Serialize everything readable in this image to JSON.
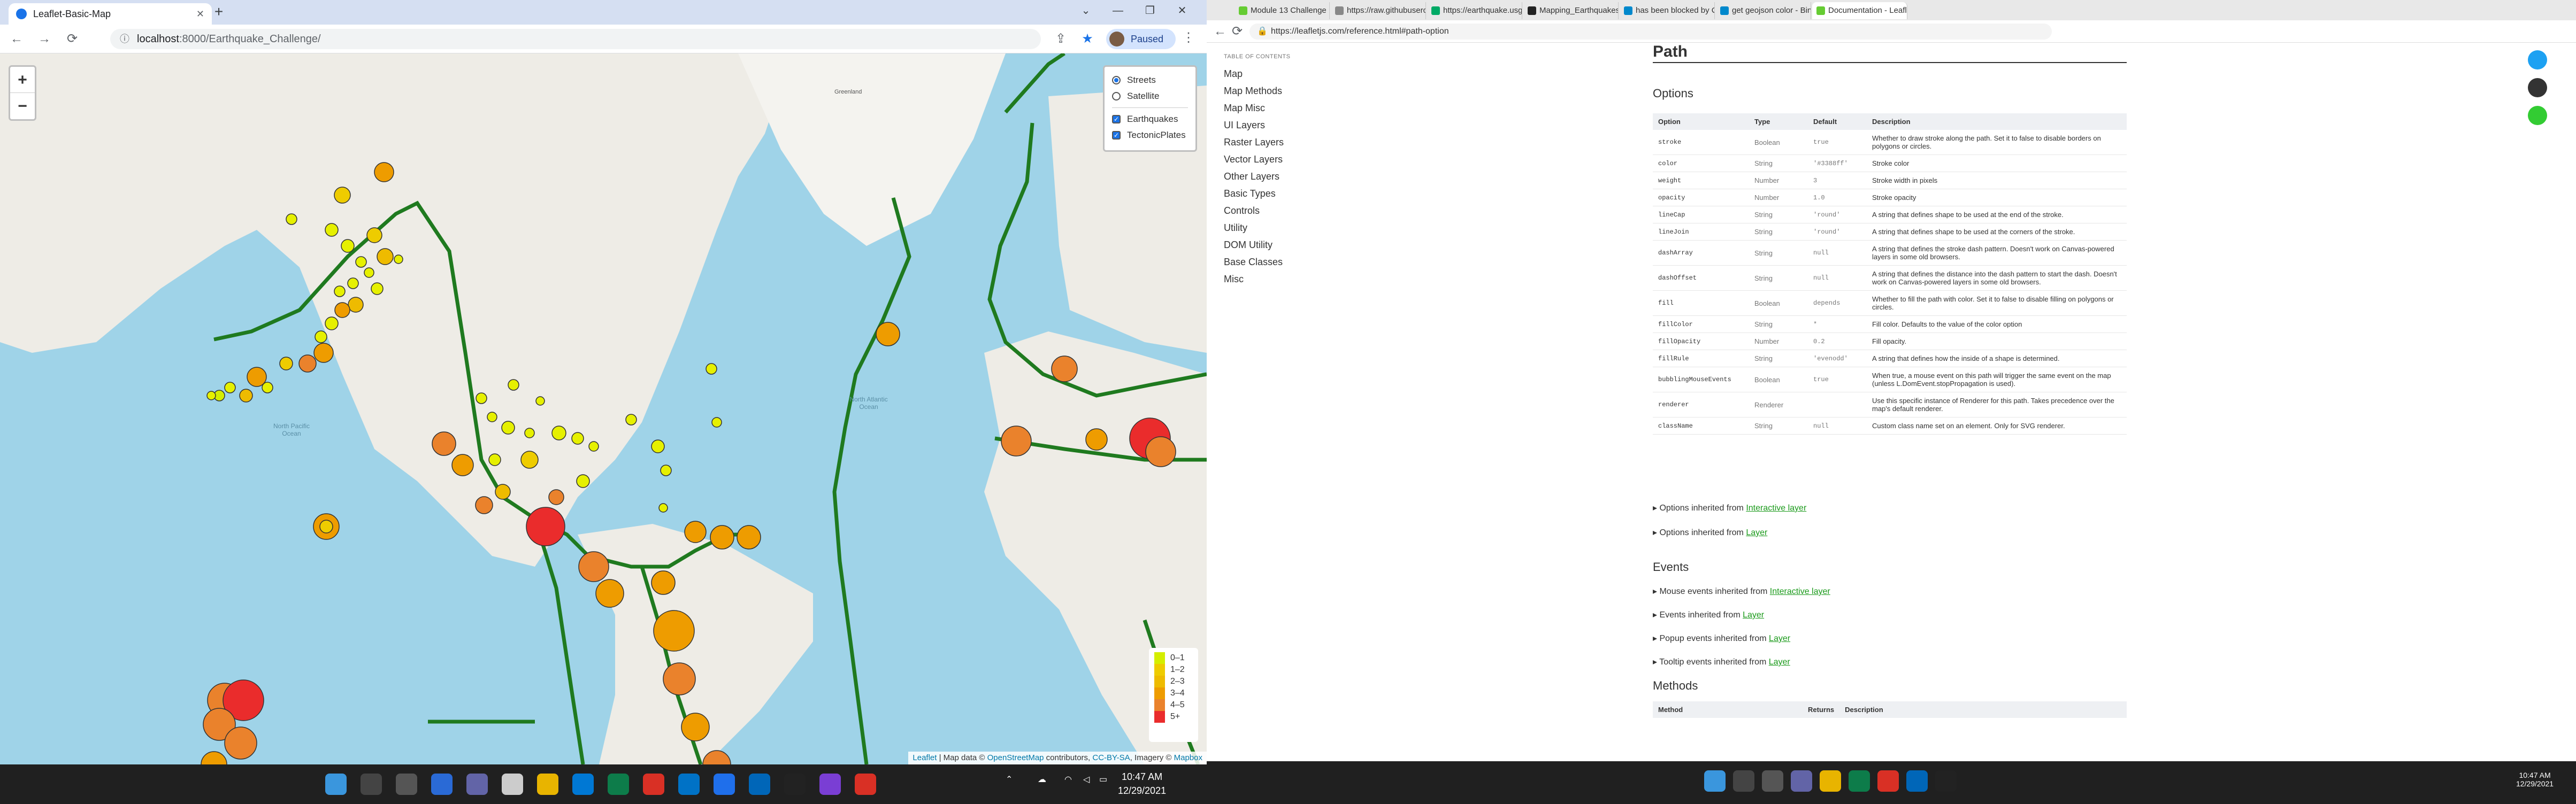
{
  "left": {
    "tab_title": "Leaflet-Basic-Map",
    "new_tab": "+",
    "url_host": "localhost",
    "url_path": ":8000/Earthquake_Challenge/",
    "paused_label": "Paused",
    "zoom_in": "+",
    "zoom_out": "−",
    "layers": {
      "base": [
        {
          "label": "Streets",
          "checked": true
        },
        {
          "label": "Satellite",
          "checked": false
        }
      ],
      "overlays": [
        {
          "label": "Earthquakes",
          "checked": true
        },
        {
          "label": "TectonicPlates",
          "checked": true
        }
      ]
    },
    "legend": [
      {
        "label": "0–1",
        "color": "#d4ee00"
      },
      {
        "label": "1–2",
        "color": "#eecc00"
      },
      {
        "label": "2–3",
        "color": "#eebb00"
      },
      {
        "label": "3–4",
        "color": "#ee9c00"
      },
      {
        "label": "4–5",
        "color": "#ea822c"
      },
      {
        "label": "5+",
        "color": "#ea2c2c"
      }
    ],
    "attribution": {
      "leaflet": "Leaflet",
      "mid": " | Map data © ",
      "osm": "OpenStreetMap",
      "mid2": " contributors, ",
      "cc": "CC-BY-SA",
      "mid3": ", Imagery © ",
      "mapbox": "Mapbox"
    },
    "map_labels": {
      "greenland": "Greenland",
      "north_atlantic": "North Atlantic Ocean",
      "north_pacific": "North Pacific Ocean"
    },
    "clock_time": "10:47 AM",
    "clock_date": "12/29/2021"
  },
  "right": {
    "tabs": [
      "Module 13 Challenge",
      "https://raw.githubusercontent...",
      "https://earthquake.usgs.gov/ear...",
      "Mapping_Earthquakes/Earthqu...",
      "has been blocked by CORS poli...",
      "get geojson color - Bing",
      "Documentation - Leaflet - a Jav..."
    ],
    "url": "https://leafletjs.com/reference.html#path-option",
    "toc_header": "TABLE OF CONTENTS",
    "toc": [
      "Map",
      "Map Methods",
      "Map Misc",
      "UI Layers",
      "Raster Layers",
      "Vector Layers",
      "Other Layers",
      "Basic Types",
      "Controls",
      "Utility",
      "DOM Utility",
      "Base Classes",
      "Misc"
    ],
    "page_title": "Path",
    "options_heading": "Options",
    "columns": [
      "Option",
      "Type",
      "Default",
      "Description"
    ],
    "rows": [
      {
        "option": "stroke",
        "type": "Boolean",
        "default": "true",
        "desc": "Whether to draw stroke along the path. Set it to false to disable borders on polygons or circles."
      },
      {
        "option": "color",
        "type": "String",
        "default": "'#3388ff'",
        "desc": "Stroke color"
      },
      {
        "option": "weight",
        "type": "Number",
        "default": "3",
        "desc": "Stroke width in pixels"
      },
      {
        "option": "opacity",
        "type": "Number",
        "default": "1.0",
        "desc": "Stroke opacity"
      },
      {
        "option": "lineCap",
        "type": "String",
        "default": "'round'",
        "desc": "A string that defines shape to be used at the end of the stroke."
      },
      {
        "option": "lineJoin",
        "type": "String",
        "default": "'round'",
        "desc": "A string that defines shape to be used at the corners of the stroke."
      },
      {
        "option": "dashArray",
        "type": "String",
        "default": "null",
        "desc": "A string that defines the stroke dash pattern. Doesn't work on Canvas-powered layers in some old browsers."
      },
      {
        "option": "dashOffset",
        "type": "String",
        "default": "null",
        "desc": "A string that defines the distance into the dash pattern to start the dash. Doesn't work on Canvas-powered layers in some old browsers."
      },
      {
        "option": "fill",
        "type": "Boolean",
        "default": "depends",
        "desc": "Whether to fill the path with color. Set it to false to disable filling on polygons or circles."
      },
      {
        "option": "fillColor",
        "type": "String",
        "default": "*",
        "desc": "Fill color. Defaults to the value of the color option"
      },
      {
        "option": "fillOpacity",
        "type": "Number",
        "default": "0.2",
        "desc": "Fill opacity."
      },
      {
        "option": "fillRule",
        "type": "String",
        "default": "'evenodd'",
        "desc": "A string that defines how the inside of a shape is determined."
      },
      {
        "option": "bubblingMouseEvents",
        "type": "Boolean",
        "default": "true",
        "desc": "When true, a mouse event on this path will trigger the same event on the map (unless L.DomEvent.stopPropagation is used)."
      },
      {
        "option": "renderer",
        "type": "Renderer",
        "default": "",
        "desc": "Use this specific instance of Renderer for this path. Takes precedence over the map's default renderer."
      },
      {
        "option": "className",
        "type": "String",
        "default": "null",
        "desc": "Custom class name set on an element. Only for SVG renderer."
      }
    ],
    "inherit_opts": [
      {
        "prefix": "▸ Options inherited from ",
        "link": "Interactive layer"
      },
      {
        "prefix": "▸ Options inherited from ",
        "link": "Layer"
      }
    ],
    "events_heading": "Events",
    "inherit_events": [
      {
        "prefix": "▸ Mouse events inherited from ",
        "link": "Interactive layer"
      },
      {
        "prefix": "▸ Events inherited from ",
        "link": "Layer"
      },
      {
        "prefix": "▸ Popup events inherited from ",
        "link": "Layer"
      },
      {
        "prefix": "▸ Tooltip events inherited from ",
        "link": "Layer"
      }
    ],
    "methods_heading": "Methods",
    "method_columns": [
      "Method",
      "Returns",
      "Description"
    ],
    "clock_time": "10:47 AM",
    "clock_date": "12/29/2021"
  }
}
